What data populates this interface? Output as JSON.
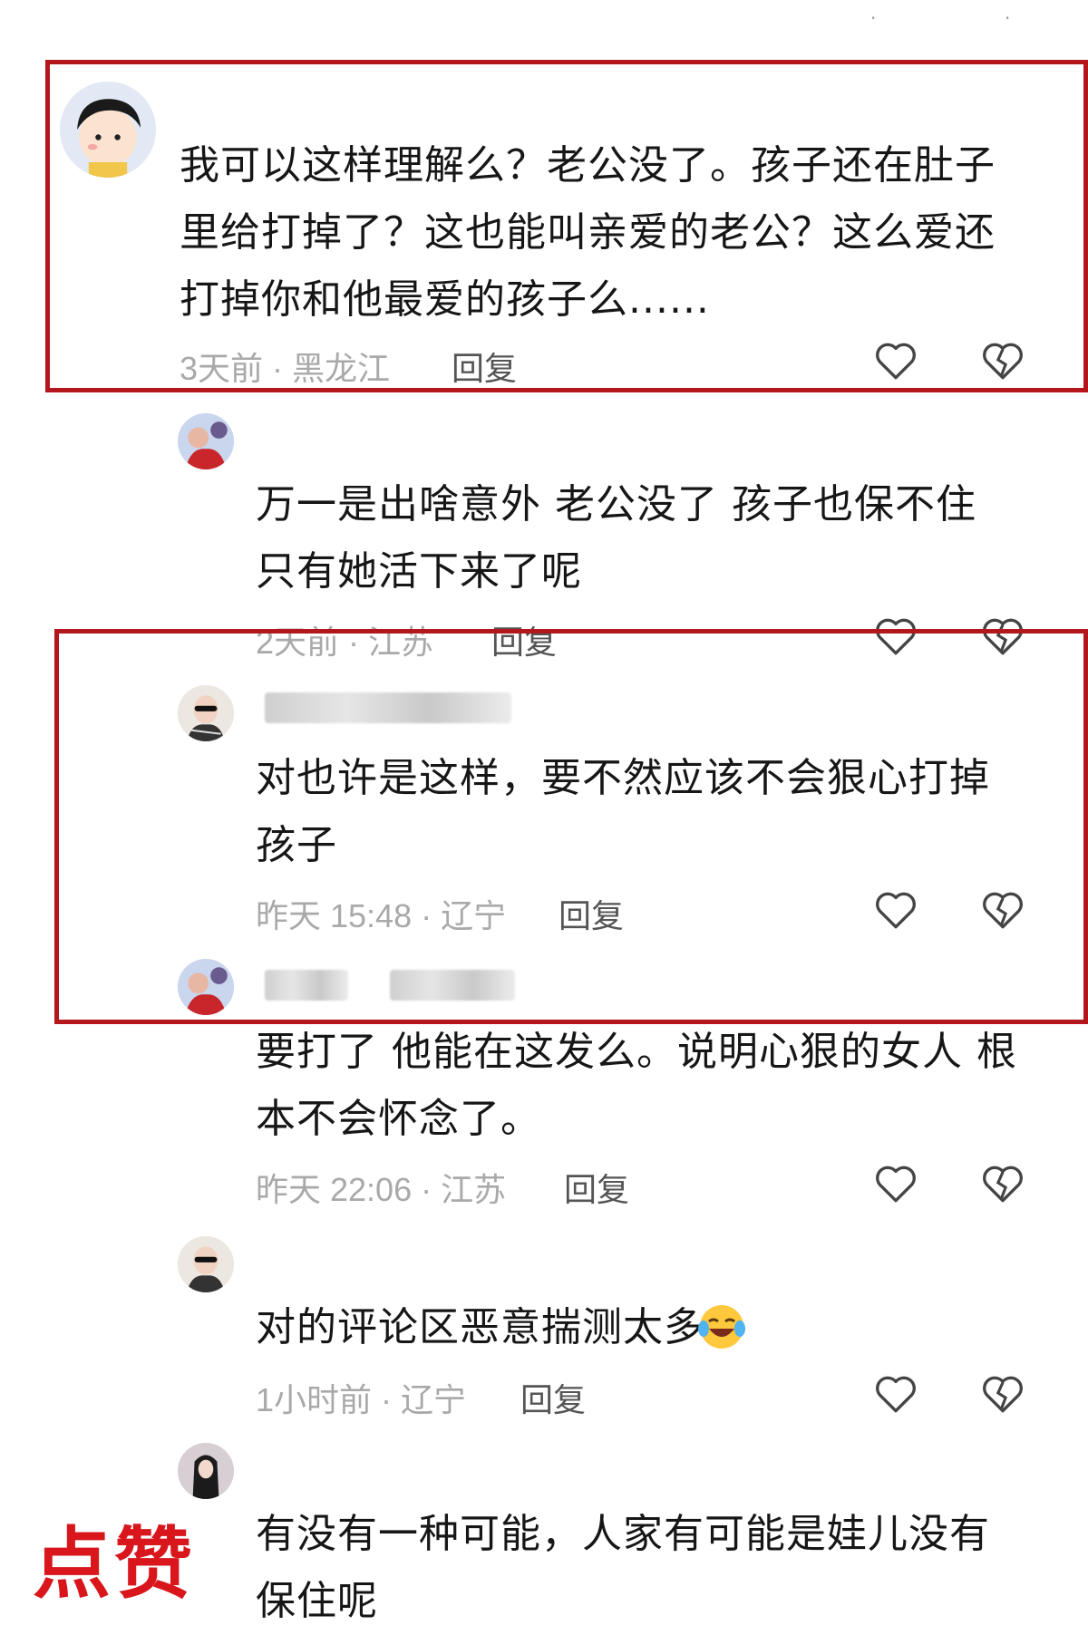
{
  "comments": [
    {
      "text": "我可以这样理解么？老公没了。孩子还在肚子里给打掉了？这也能叫亲爱的老公？这么爱还打掉你和他最爱的孩子么......",
      "meta": "3天前 · 黑龙江",
      "reply": "回复"
    },
    {
      "text": "万一是出啥意外 老公没了 孩子也保不住 只有她活下来了呢",
      "meta": "2天前 · 江苏",
      "reply": "回复"
    },
    {
      "text": "对也许是这样，要不然应该不会狠心打掉孩子",
      "meta": "昨天 15:48 · 辽宁",
      "reply": "回复"
    },
    {
      "text": "要打了 他能在这发么。说明心狠的女人 根本不会怀念了。",
      "meta": "昨天 22:06 · 江苏",
      "reply": "回复"
    },
    {
      "text": "对的评论区恶意揣测太多",
      "meta": "1小时前 · 辽宁",
      "reply": "回复"
    },
    {
      "text": "有没有一种可能，人家有可能是娃儿没有保住呢",
      "meta": "",
      "reply": ""
    }
  ],
  "watermark": "点赞",
  "colors": {
    "highlight_box": "#b3171c",
    "meta": "#a9a9a9",
    "watermark": "#d8161c"
  },
  "icons": [
    "heart-icon",
    "broken-heart-icon",
    "crying-laughing-emoji"
  ]
}
